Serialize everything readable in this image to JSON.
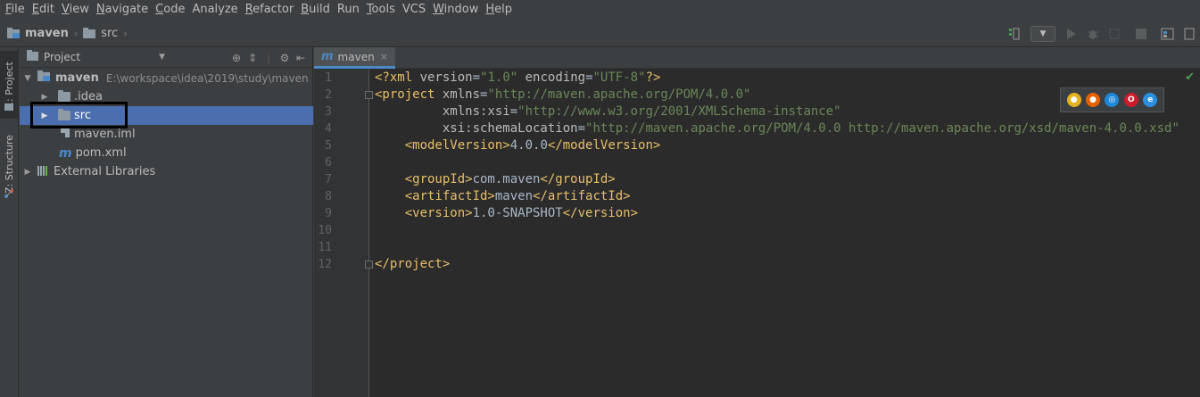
{
  "menu": {
    "items": [
      {
        "u": "F",
        "rest": "ile"
      },
      {
        "u": "E",
        "rest": "dit"
      },
      {
        "u": "V",
        "rest": "iew"
      },
      {
        "u": "N",
        "rest": "avigate"
      },
      {
        "u": "C",
        "rest": "ode"
      },
      {
        "u": "",
        "rest": "Analyze"
      },
      {
        "u": "R",
        "rest": "efactor"
      },
      {
        "u": "B",
        "rest": "uild"
      },
      {
        "u": "",
        "rest": "Run"
      },
      {
        "u": "T",
        "rest": "ools"
      },
      {
        "u": "",
        "rest": "VCS"
      },
      {
        "u": "W",
        "rest": "indow"
      },
      {
        "u": "H",
        "rest": "elp"
      }
    ]
  },
  "breadcrumb": {
    "project": "maven",
    "folder": "src"
  },
  "strip": {
    "project_tab": "1: Project",
    "structure_tab": "Z: Structure"
  },
  "project_panel": {
    "title": "Project",
    "root": {
      "name": "maven",
      "path": "E:\\workspace\\idea\\2019\\study\\maven"
    },
    "items": {
      "idea": ".idea",
      "src": "src",
      "iml": "maven.iml",
      "pom": "pom.xml",
      "libs": "External Libraries"
    }
  },
  "editor": {
    "tab_label": "maven",
    "tab_icon": "m",
    "line_numbers": [
      "1",
      "2",
      "3",
      "4",
      "5",
      "6",
      "7",
      "8",
      "9",
      "10",
      "11",
      "12"
    ],
    "lines": {
      "l1": {
        "open": "<?xml ",
        "a1": "version",
        "eq1": "=",
        "v1": "\"1.0\"",
        "sp": " ",
        "a2": "encoding",
        "eq2": "=",
        "v2": "\"UTF-8\"",
        "close": "?>"
      },
      "l2": {
        "open": "<project ",
        "a1": "xmlns",
        "eq": "=",
        "v1": "\"http://maven.apache.org/POM/4.0.0\""
      },
      "l3": {
        "indent": "         ",
        "a1": "xmlns:xsi",
        "eq": "=",
        "v1": "\"http://www.w3.org/2001/XMLSchema-instance\""
      },
      "l4": {
        "indent": "         ",
        "a1": "xsi:schemaLocation",
        "eq": "=",
        "v1": "\"http://maven.apache.org/POM/4.0.0 http://maven.apache.org/xsd/maven-4.0.0.xsd\""
      },
      "l5": {
        "indent": "    ",
        "ot": "<modelVersion>",
        "text": "4.0.0",
        "ct": "</modelVersion>"
      },
      "l7": {
        "indent": "    ",
        "ot": "<groupId>",
        "text": "com.maven",
        "ct": "</groupId>"
      },
      "l8": {
        "indent": "    ",
        "ot": "<artifactId>",
        "text": "maven",
        "ct": "</artifactId>"
      },
      "l9": {
        "indent": "    ",
        "ot": "<version>",
        "text": "1.0-SNAPSHOT",
        "ct": "</version>"
      },
      "l12": {
        "ct": "</project>"
      }
    },
    "browsers": [
      {
        "name": "chrome-icon",
        "color": "#e4b121"
      },
      {
        "name": "firefox-icon",
        "color": "#e66000"
      },
      {
        "name": "safari-icon",
        "color": "#1e88d8"
      },
      {
        "name": "opera-icon",
        "color": "#cc1b2c"
      },
      {
        "name": "ie-icon",
        "color": "#2b8fe0"
      }
    ]
  },
  "colors": {
    "selection": "#4b6eaf",
    "tag": "#e8bf6a",
    "value": "#6a8759",
    "accent": "#4a88c7"
  }
}
